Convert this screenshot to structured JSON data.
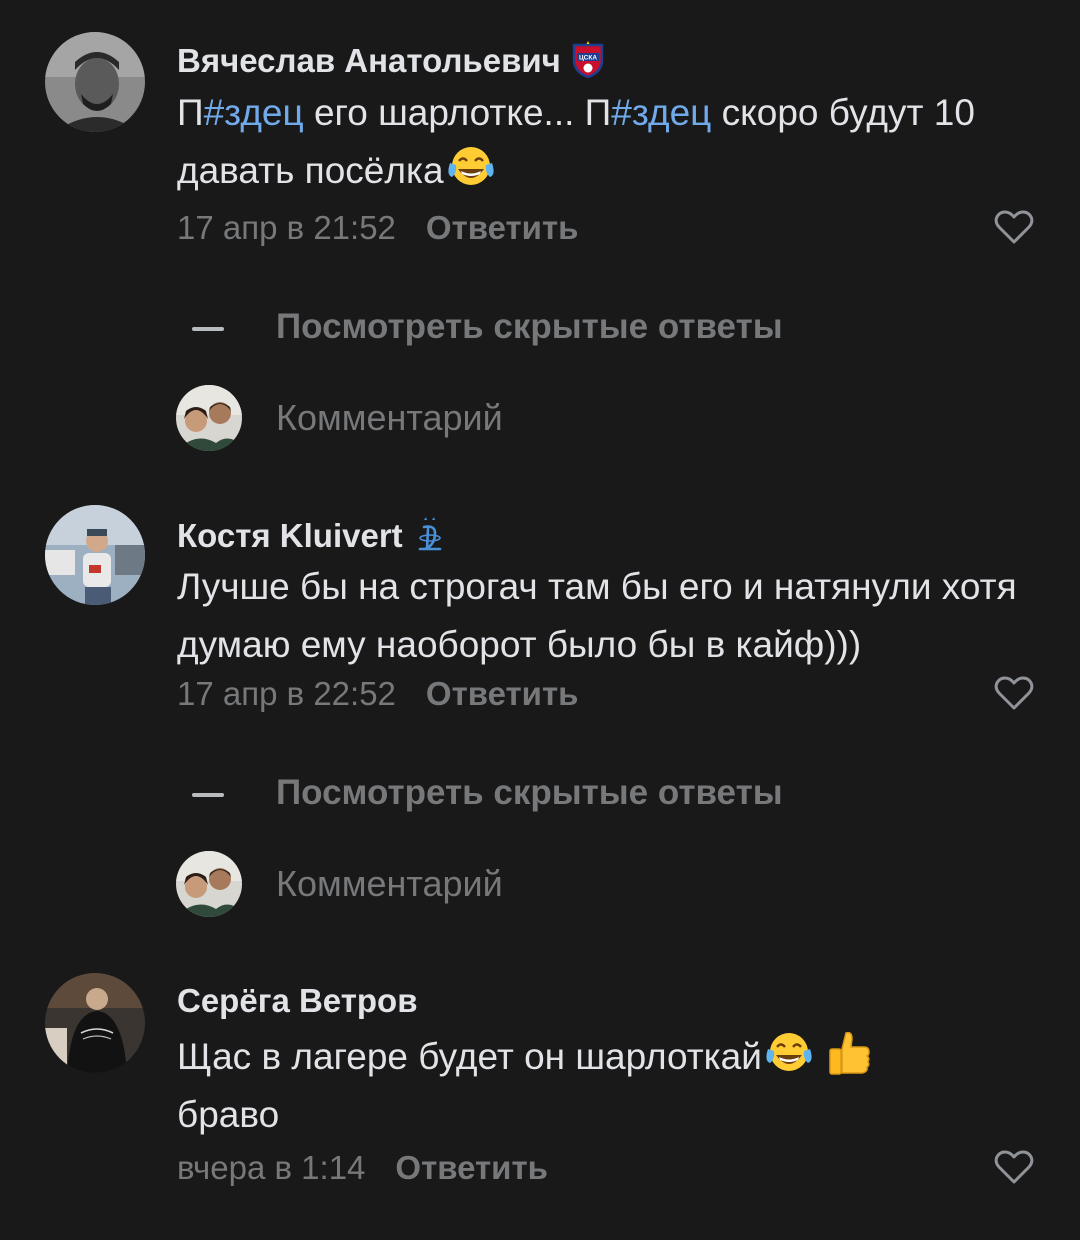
{
  "comments": [
    {
      "author": "Вячеслав Анатольевич",
      "badge": "cska-club-badge",
      "text_parts": [
        "П",
        "#здец",
        " его шарлотке... П",
        "#здец",
        " скоро будут 10 давать посёлка"
      ],
      "emoji": [
        "tears-of-joy-emoji"
      ],
      "date": "17 апр в 21:52",
      "reply_label": "Ответить",
      "liked": false
    },
    {
      "author": "Костя Kluivert",
      "badge": "dynamo-club-badge",
      "text": "Лучше бы на строгач там бы его и натянули хотя думаю ему наоборот было бы в кайф)))",
      "date": "17 апр в 22:52",
      "reply_label": "Ответить",
      "liked": false
    },
    {
      "author": "Серёга Ветров",
      "text_line1": "Щас в лагере будет он шарлоткай",
      "emoji": [
        "tears-of-joy-emoji",
        "thumbs-up-emoji"
      ],
      "text_line2": "браво",
      "date": "вчера в 1:14",
      "reply_label": "Ответить",
      "liked": false
    }
  ],
  "thread": {
    "show_hidden_label": "Посмотреть скрытые ответы",
    "comment_placeholder": "Комментарий"
  },
  "colors": {
    "background": "#19191a",
    "text_primary": "#e1e3e6",
    "text_secondary": "#76787a",
    "hashtag": "#71aaeb"
  }
}
